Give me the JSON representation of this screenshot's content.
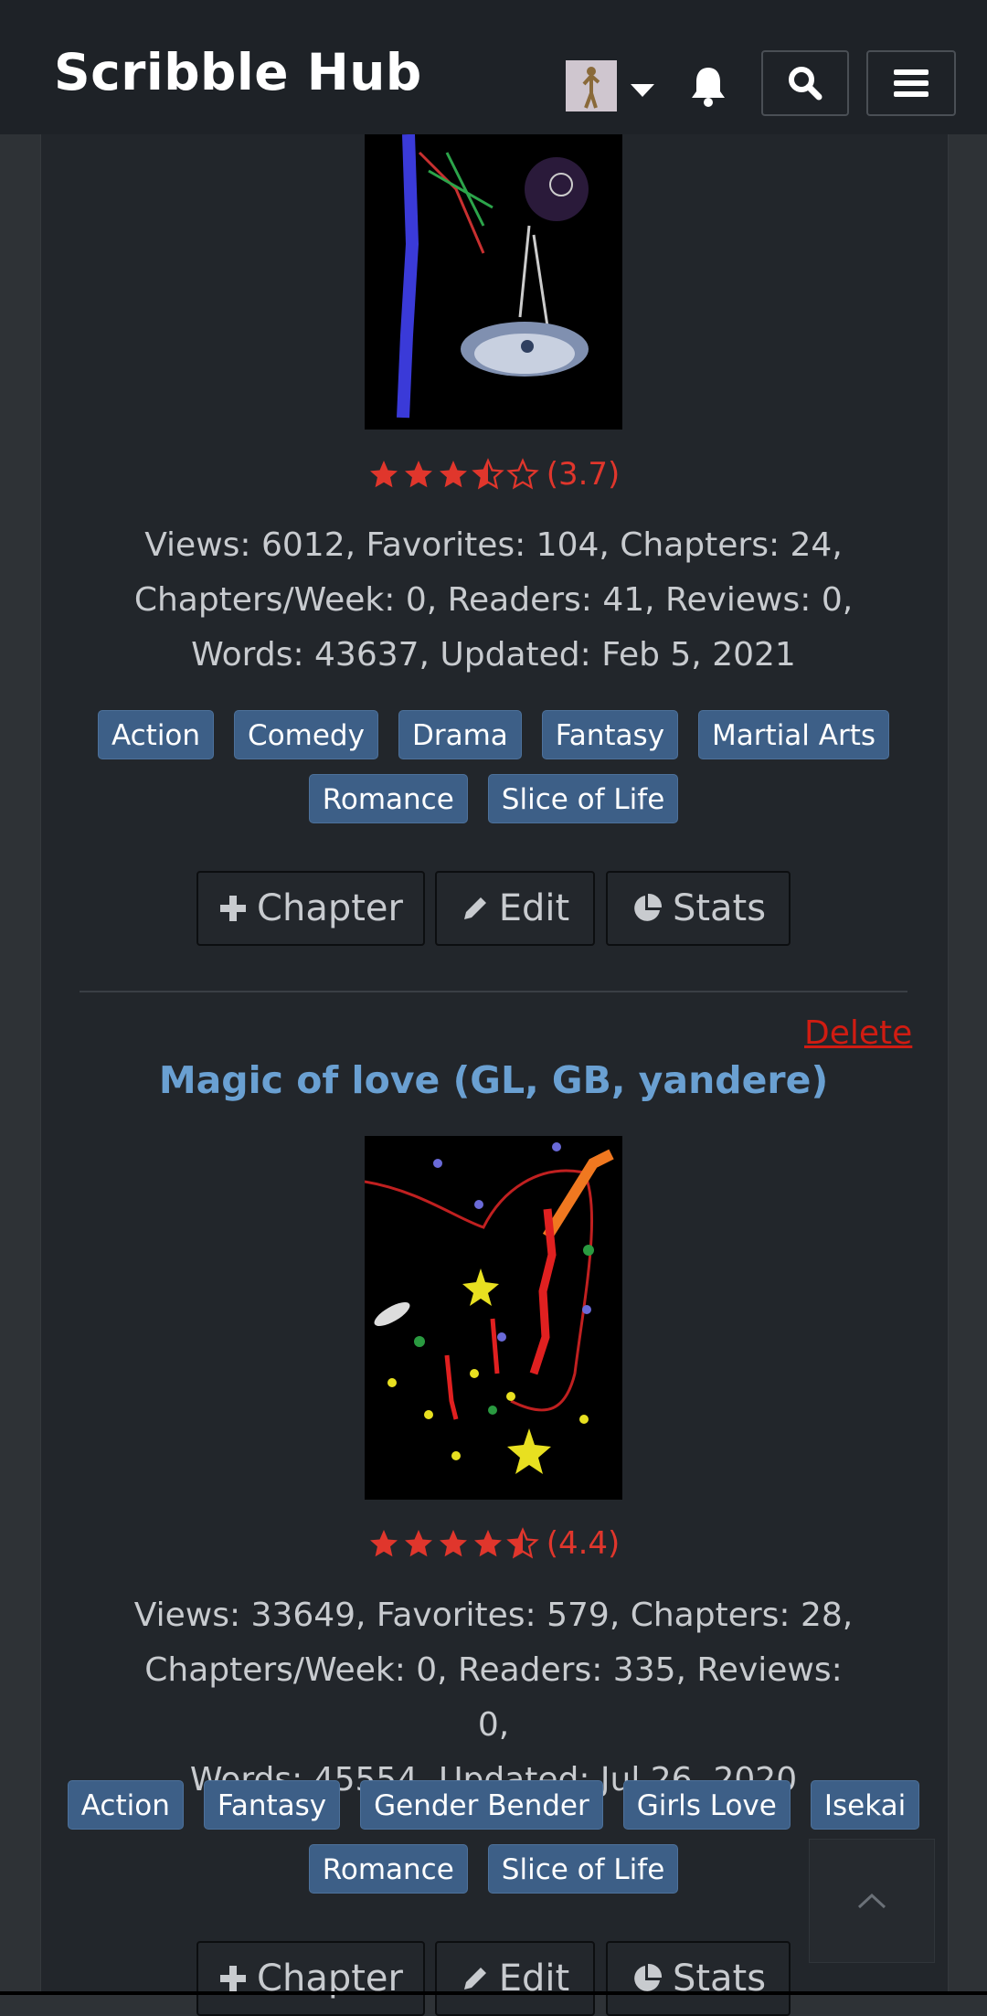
{
  "header": {
    "brand": "Scribble Hub",
    "avatar_icon": "user-avatar",
    "dropdown_icon": "caret-down-icon",
    "notifications_icon": "bell-icon",
    "search_icon": "search-icon",
    "menu_icon": "hamburger-icon"
  },
  "novels": [
    {
      "title": "",
      "rating_display": "(3.7)",
      "rating": 3.7,
      "stats_line1": "Views: 6012, Favorites: 104, Chapters: 24,",
      "stats_line2": "Chapters/Week: 0, Readers: 41, Reviews: 0,",
      "stats_line3": "Words: 43637, Updated: Feb 5, 2021",
      "tags_row1": [
        "Action",
        "Comedy",
        "Drama",
        "Fantasy",
        "Martial Arts"
      ],
      "tags_row2": [
        "Romance",
        "Slice of Life"
      ],
      "actions": {
        "chapter": "Chapter",
        "edit": "Edit",
        "stats": "Stats"
      }
    },
    {
      "delete_label": "Delete",
      "title": "Magic of love (GL, GB, yandere)",
      "rating_display": "(4.4)",
      "rating": 4.4,
      "stats_line1": "Views: 33649, Favorites: 579, Chapters: 28,",
      "stats_line2": "Chapters/Week: 0, Readers: 335, Reviews: 0,",
      "stats_line3": "Words: 45554, Updated: Jul 26, 2020",
      "tags_row1": [
        "Action",
        "Fantasy",
        "Gender Bender",
        "Girls Love",
        "Isekai"
      ],
      "tags_row2": [
        "Romance",
        "Slice of Life"
      ],
      "actions": {
        "chapter": "Chapter",
        "edit": "Edit",
        "stats": "Stats"
      }
    }
  ],
  "colors": {
    "background": "#2e3236",
    "card": "#22262b",
    "header": "#1e2227",
    "rating": "#e0362c",
    "title": "#6aa0d2",
    "tag": "#3d5f87",
    "delete": "#d01c12"
  },
  "scroll_top_icon": "chevron-up-icon"
}
